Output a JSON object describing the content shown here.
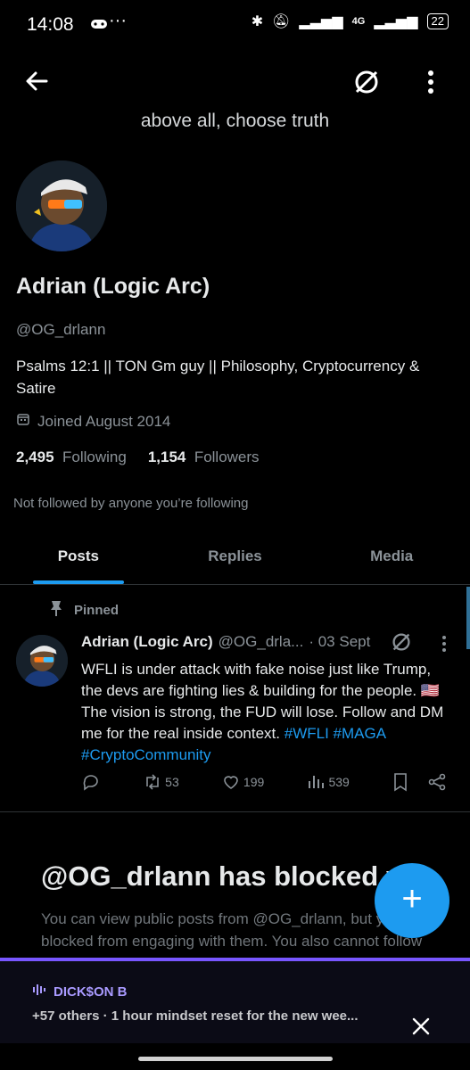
{
  "status_bar": {
    "time": "14:08",
    "battery": "22",
    "network": "4G"
  },
  "header": {
    "banner_text": "above all, choose truth",
    "icons": [
      "back-arrow-icon",
      "grok-icon",
      "more-vertical-icon"
    ]
  },
  "profile": {
    "name": "Adrian (Logic Arc)",
    "handle": "@OG_drlann",
    "bio": "Psalms 12:1 || TON Gm guy || Philosophy, Cryptocurrency & Satire",
    "joined": "Joined August 2014",
    "following_count": "2,495",
    "following_label": "Following",
    "followers_count": "1,154",
    "followers_label": "Followers",
    "not_followed": "Not followed by anyone you’re following"
  },
  "tabs": [
    {
      "label": "Posts",
      "active": true
    },
    {
      "label": "Replies",
      "active": false
    },
    {
      "label": "Media",
      "active": false
    }
  ],
  "pinned_post": {
    "pinned_label": "Pinned",
    "author": "Adrian (Logic Arc)",
    "handle_trunc": "@OG_drla...",
    "date": "· 03 Sept",
    "text_main": "WFLI is under attack with fake noise just like Trump, the devs are fighting lies & building for the people. 🇺🇸 The vision is strong, the FUD will lose. Follow and DM me for the real inside context.",
    "hashtag1": "#WFLI",
    "hashtag2": "#MAGA",
    "hashtag3": "#CryptoCommunity",
    "reposts": "53",
    "likes": "199",
    "views": "539"
  },
  "blocked": {
    "title": "@OG_drlann has blocked y",
    "text": "You can view public posts from @OG_drlann, but you are blocked from engaging with them. You also cannot follow or message @OG_drlann."
  },
  "fab": {
    "label": "+"
  },
  "space_bar": {
    "host": "DICK$ON B",
    "title": "+57 others · 1 hour mindset reset for the new wee..."
  },
  "colors": {
    "accent": "#1d9bf0",
    "space_accent": "#7856ff"
  }
}
